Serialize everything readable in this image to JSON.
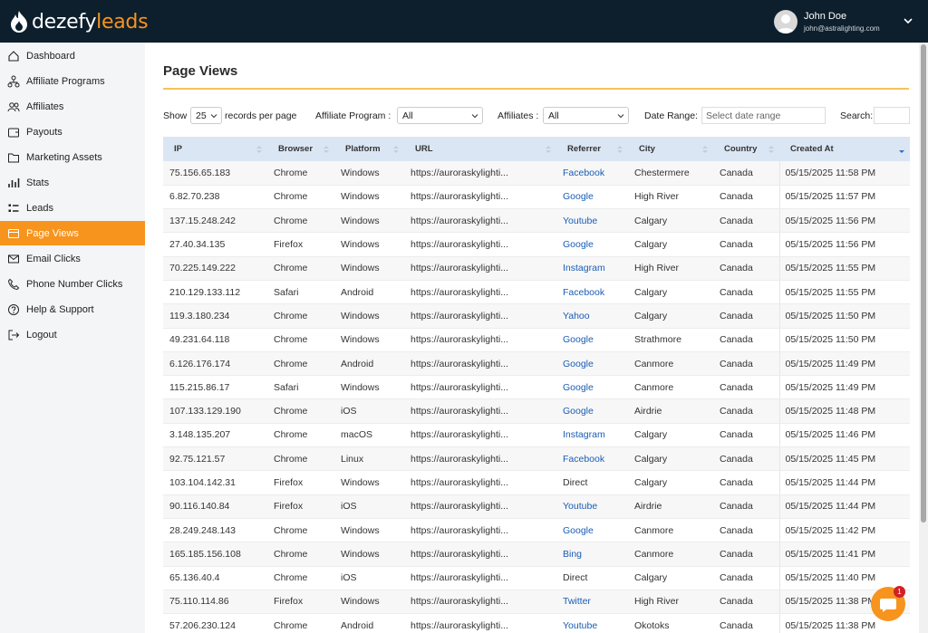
{
  "brand": {
    "name_main": "dezefy",
    "name_accent": "leads"
  },
  "user": {
    "name": "John Doe",
    "email": "john@astralighting.com"
  },
  "sidebar": {
    "items": [
      {
        "label": "Dashboard",
        "icon": "home-icon"
      },
      {
        "label": "Affiliate Programs",
        "icon": "network-icon"
      },
      {
        "label": "Affiliates",
        "icon": "users-icon"
      },
      {
        "label": "Payouts",
        "icon": "wallet-icon"
      },
      {
        "label": "Marketing Assets",
        "icon": "folder-icon"
      },
      {
        "label": "Stats",
        "icon": "bar-chart-icon"
      },
      {
        "label": "Leads",
        "icon": "list-icon"
      },
      {
        "label": "Page Views",
        "icon": "window-icon",
        "active": true
      },
      {
        "label": "Email Clicks",
        "icon": "mail-icon"
      },
      {
        "label": "Phone Number Clicks",
        "icon": "phone-icon"
      },
      {
        "label": "Help & Support",
        "icon": "question-icon"
      },
      {
        "label": "Logout",
        "icon": "logout-icon"
      }
    ]
  },
  "page": {
    "title": "Page Views"
  },
  "filters": {
    "show_label": "Show",
    "page_size": "25",
    "records_label": "records per page",
    "program_label": "Affiliate Program :",
    "program_value": "All",
    "affiliates_label": "Affiliates :",
    "affiliates_value": "All",
    "date_label": "Date Range:",
    "date_placeholder": "Select date range",
    "search_label": "Search:"
  },
  "table": {
    "columns": [
      "IP",
      "Browser",
      "Platform",
      "URL",
      "Referrer",
      "City",
      "Country",
      "Created At"
    ],
    "rows": [
      [
        "75.156.65.183",
        "Chrome",
        "Windows",
        "https://auroraskylighti...",
        "Facebook",
        "Chestermere",
        "Canada",
        "05/15/2025 11:58 PM"
      ],
      [
        "6.82.70.238",
        "Chrome",
        "Windows",
        "https://auroraskylighti...",
        "Google",
        "High River",
        "Canada",
        "05/15/2025 11:57 PM"
      ],
      [
        "137.15.248.242",
        "Chrome",
        "Windows",
        "https://auroraskylighti...",
        "Youtube",
        "Calgary",
        "Canada",
        "05/15/2025 11:56 PM"
      ],
      [
        "27.40.34.135",
        "Firefox",
        "Windows",
        "https://auroraskylighti...",
        "Google",
        "Calgary",
        "Canada",
        "05/15/2025 11:56 PM"
      ],
      [
        "70.225.149.222",
        "Chrome",
        "Windows",
        "https://auroraskylighti...",
        "Instagram",
        "High River",
        "Canada",
        "05/15/2025 11:55 PM"
      ],
      [
        "210.129.133.112",
        "Safari",
        "Android",
        "https://auroraskylighti...",
        "Facebook",
        "Calgary",
        "Canada",
        "05/15/2025 11:55 PM"
      ],
      [
        "119.3.180.234",
        "Chrome",
        "Windows",
        "https://auroraskylighti...",
        "Yahoo",
        "Calgary",
        "Canada",
        "05/15/2025 11:50 PM"
      ],
      [
        "49.231.64.118",
        "Chrome",
        "Windows",
        "https://auroraskylighti...",
        "Google",
        "Strathmore",
        "Canada",
        "05/15/2025 11:50 PM"
      ],
      [
        "6.126.176.174",
        "Chrome",
        "Android",
        "https://auroraskylighti...",
        "Google",
        "Canmore",
        "Canada",
        "05/15/2025 11:49 PM"
      ],
      [
        "115.215.86.17",
        "Safari",
        "Windows",
        "https://auroraskylighti...",
        "Google",
        "Canmore",
        "Canada",
        "05/15/2025 11:49 PM"
      ],
      [
        "107.133.129.190",
        "Chrome",
        "iOS",
        "https://auroraskylighti...",
        "Google",
        "Airdrie",
        "Canada",
        "05/15/2025 11:48 PM"
      ],
      [
        "3.148.135.207",
        "Chrome",
        "macOS",
        "https://auroraskylighti...",
        "Instagram",
        "Calgary",
        "Canada",
        "05/15/2025 11:46 PM"
      ],
      [
        "92.75.121.57",
        "Chrome",
        "Linux",
        "https://auroraskylighti...",
        "Facebook",
        "Calgary",
        "Canada",
        "05/15/2025 11:45 PM"
      ],
      [
        "103.104.142.31",
        "Firefox",
        "Windows",
        "https://auroraskylighti...",
        "Direct",
        "Calgary",
        "Canada",
        "05/15/2025 11:44 PM"
      ],
      [
        "90.116.140.84",
        "Firefox",
        "iOS",
        "https://auroraskylighti...",
        "Youtube",
        "Airdrie",
        "Canada",
        "05/15/2025 11:44 PM"
      ],
      [
        "28.249.248.143",
        "Chrome",
        "Windows",
        "https://auroraskylighti...",
        "Google",
        "Canmore",
        "Canada",
        "05/15/2025 11:42 PM"
      ],
      [
        "165.185.156.108",
        "Chrome",
        "Windows",
        "https://auroraskylighti...",
        "Bing",
        "Canmore",
        "Canada",
        "05/15/2025 11:41 PM"
      ],
      [
        "65.136.40.4",
        "Chrome",
        "iOS",
        "https://auroraskylighti...",
        "Direct",
        "Calgary",
        "Canada",
        "05/15/2025 11:40 PM"
      ],
      [
        "75.110.114.86",
        "Firefox",
        "Windows",
        "https://auroraskylighti...",
        "Twitter",
        "High River",
        "Canada",
        "05/15/2025 11:38 PM"
      ],
      [
        "57.206.230.124",
        "Chrome",
        "Android",
        "https://auroraskylighti...",
        "Youtube",
        "Okotoks",
        "Canada",
        "05/15/2025 11:38 PM"
      ]
    ]
  },
  "chat": {
    "badge": "1"
  },
  "colors": {
    "topbar": "#0d1f2d",
    "accent": "#f7941d",
    "link": "#1a5db5",
    "header_row": "#dbe6f4"
  }
}
